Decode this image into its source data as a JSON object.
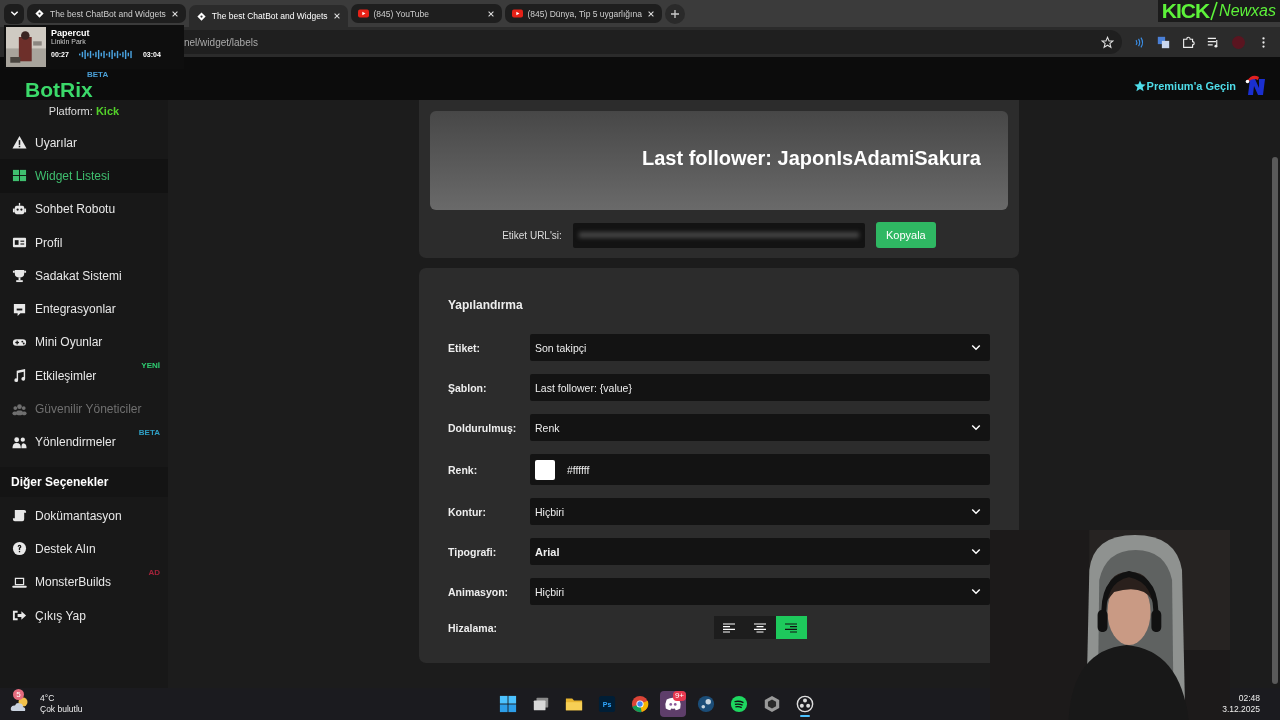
{
  "browser": {
    "tabs": [
      {
        "title": "The best ChatBot and Widgets",
        "kind": "diamond",
        "selected": false
      },
      {
        "title": "The best ChatBot and Widgets",
        "kind": "diamond",
        "selected": true
      },
      {
        "title": "(845) YouTube",
        "kind": "play",
        "selected": false
      },
      {
        "title": "(845) Dünya, Tip 5 uygarlığına",
        "kind": "play",
        "selected": false
      }
    ],
    "url": "nel/widget/labels"
  },
  "media_player": {
    "title": "Papercut",
    "artist": "Linkin Park",
    "elapsed": "00:27",
    "duration": "03:04"
  },
  "stream_overlay": {
    "logo_left": "KICK",
    "logo_right": "Newxas"
  },
  "header": {
    "brand": "BotRix",
    "brand_badge": "BETA",
    "premium": "Premium'a Geçin"
  },
  "sidebar": {
    "platform_label": "Platform:",
    "platform": "Kick",
    "items": [
      {
        "label": "Uyarılar",
        "kind": "warning",
        "selected": false,
        "disabled": false
      },
      {
        "label": "Widget Listesi",
        "kind": "grid",
        "selected": true,
        "disabled": false
      },
      {
        "label": "Sohbet Robotu",
        "kind": "robot",
        "selected": false,
        "disabled": false
      },
      {
        "label": "Profil",
        "kind": "idcard",
        "selected": false,
        "disabled": false
      },
      {
        "label": "Sadakat Sistemi",
        "kind": "trophy",
        "selected": false,
        "disabled": false
      },
      {
        "label": "Entegrasyonlar",
        "kind": "chat",
        "selected": false,
        "disabled": false
      },
      {
        "label": "Mini Oyunlar",
        "kind": "gamepad",
        "selected": false,
        "disabled": false
      },
      {
        "label": "Etkileşimler",
        "kind": "music",
        "selected": false,
        "disabled": false,
        "badge": "YENİ",
        "color": "#2ecc71"
      },
      {
        "label": "Güvenilir Yöneticiler",
        "kind": "group",
        "selected": false,
        "disabled": true
      },
      {
        "label": "Yönlendirmeler",
        "kind": "users",
        "selected": false,
        "disabled": false,
        "badge": "BETA",
        "color": "#2f9fc4"
      }
    ],
    "section": "Diğer Seçenekler",
    "more_items": [
      {
        "label": "Dokümantasyon",
        "kind": "scroll",
        "selected": false,
        "disabled": false
      },
      {
        "label": "Destek Alın",
        "kind": "question",
        "selected": false,
        "disabled": false
      },
      {
        "label": "MonsterBuilds",
        "kind": "laptop",
        "selected": false,
        "disabled": false,
        "badge": "AD",
        "color": "#a3233a"
      },
      {
        "label": "Çıkış Yap",
        "kind": "logout",
        "selected": false,
        "disabled": false
      }
    ]
  },
  "preview": {
    "text": "Last follower: JaponIsAdamiSakura",
    "url_label": "Etiket URL'si:",
    "copy_button": "Kopyala"
  },
  "config": {
    "title": "Yapılandırma",
    "fields": [
      {
        "label": "Etiket:",
        "kind": "select",
        "value": "Son takipçi"
      },
      {
        "label": "Şablon:",
        "kind": "text",
        "value": "Last follower: {value}"
      },
      {
        "label": "Doldurulmuş:",
        "kind": "select",
        "value": "Renk"
      },
      {
        "label": "Renk:",
        "kind": "color",
        "value": "#ffffff",
        "color": "#ffffff"
      },
      {
        "label": "Kontur:",
        "kind": "select",
        "value": "Hiçbiri"
      },
      {
        "label": "Tipografi:",
        "kind": "select",
        "value": "Arial",
        "bold": true
      },
      {
        "label": "Animasyon:",
        "kind": "select",
        "value": "Hiçbiri"
      }
    ],
    "alignment": {
      "label": "Hizalama:",
      "options": [
        {
          "kind": "left",
          "selected": false
        },
        {
          "kind": "center",
          "selected": false
        },
        {
          "kind": "right",
          "selected": true
        }
      ]
    }
  },
  "taskbar": {
    "weather": {
      "badge": "5",
      "temperature": "4°C",
      "condition": "Çok bulutlu"
    },
    "apps": [
      {
        "kind": "start",
        "selected": false,
        "running": false
      },
      {
        "kind": "taskview",
        "selected": false,
        "running": false
      },
      {
        "kind": "folder",
        "selected": false,
        "running": false
      },
      {
        "kind": "photoshop",
        "label": "Ps",
        "selected": false,
        "running": false
      },
      {
        "kind": "chrome",
        "selected": false,
        "running": false
      },
      {
        "kind": "discord",
        "badge": "9+",
        "selected": true,
        "running": false
      },
      {
        "kind": "steam",
        "selected": false,
        "running": false
      },
      {
        "kind": "spotify",
        "selected": false,
        "running": false
      },
      {
        "kind": "cube",
        "selected": false,
        "running": false
      },
      {
        "kind": "recorder",
        "selected": false,
        "running": true
      }
    ],
    "time": "02:48",
    "date": "3.12.2025"
  }
}
